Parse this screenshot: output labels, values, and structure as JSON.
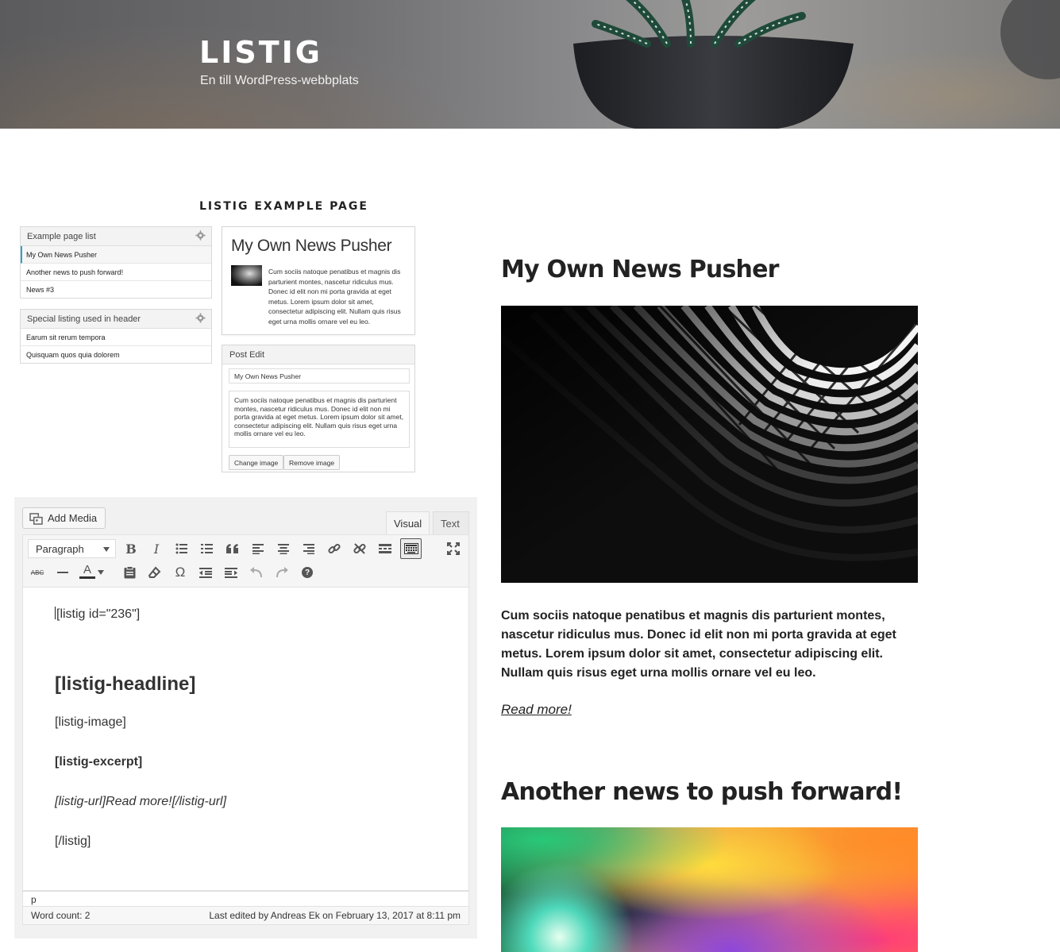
{
  "site": {
    "title": "LISTIG",
    "description": "En till WordPress-webbplats"
  },
  "page": {
    "title": "LISTIG EXAMPLE PAGE"
  },
  "widgets": [
    {
      "title": "Example page list",
      "items": [
        "My Own News Pusher",
        "Another news to push forward!",
        "News #3"
      ],
      "active_index": 0
    },
    {
      "title": "Special listing used in header",
      "items": [
        "Earum sit rerum tempora",
        "Quisquam quos quia dolorem"
      ]
    }
  ],
  "preview_card": {
    "title": "My Own News Pusher",
    "text": "Cum sociis natoque penatibus et magnis dis parturient montes, nascetur ridiculus mus. Donec id elit non mi porta gravida at eget metus. Lorem ipsum dolor sit amet, consectetur adipiscing elit. Nullam quis risus eget urna mollis ornare vel eu leo."
  },
  "post_edit": {
    "title": "Post Edit",
    "title_value": "My Own News Pusher",
    "excerpt_value": "Cum sociis natoque penatibus et magnis dis parturient montes, nascetur ridiculus mus. Donec id elit non mi porta gravida at eget metus. Lorem ipsum dolor sit amet, consectetur adipiscing elit. Nullam quis risus eget urna mollis ornare vel eu leo.",
    "change_image_label": "Change image",
    "remove_image_label": "Remove image"
  },
  "editor": {
    "add_media_label": "Add Media",
    "tabs": {
      "visual": "Visual",
      "text": "Text",
      "active": "visual"
    },
    "format_select": "Paragraph",
    "toolbar_row1": [
      "bold-icon",
      "italic-icon",
      "bullet-list-icon",
      "numbered-list-icon",
      "blockquote-icon",
      "align-left-icon",
      "align-center-icon",
      "align-right-icon",
      "link-icon",
      "unlink-icon",
      "read-more-icon",
      "toolbar-toggle-icon",
      "fullscreen-icon"
    ],
    "toolbar_row2": [
      "strikethrough-icon",
      "horizontal-line-icon",
      "text-color-icon",
      "paste-as-text-icon",
      "clear-formatting-icon",
      "special-character-icon",
      "outdent-icon",
      "indent-icon",
      "undo-icon",
      "redo-icon",
      "help-icon"
    ],
    "toolbar_glyphs": {
      "bold": "B",
      "italic": "I",
      "strikethrough": "ABC",
      "text_color": "A",
      "special_char": "Ω",
      "help": "?"
    },
    "content": {
      "shortcode_open": "[listig id=\"236\"]",
      "headline": "[listig-headline]",
      "image": "[listig-image]",
      "excerpt": "[listig-excerpt]",
      "url": "[listig-url]Read more![/listig-url]",
      "shortcode_close": "[/listig]"
    },
    "path": "p",
    "word_count": "Word count: 2",
    "last_edited": "Last edited by Andreas Ek on February 13, 2017 at 8:11 pm"
  },
  "articles": [
    {
      "title": "My Own News Pusher",
      "excerpt": "Cum sociis natoque penatibus et magnis dis parturient montes, nascetur ridiculus mus. Donec id elit non mi porta gravida at eget metus. Lorem ipsum dolor sit amet, consectetur adipiscing elit. Nullam quis risus eget urna mollis ornare vel eu leo.",
      "read_more": "Read more!"
    },
    {
      "title": "Another news to push forward!"
    }
  ]
}
